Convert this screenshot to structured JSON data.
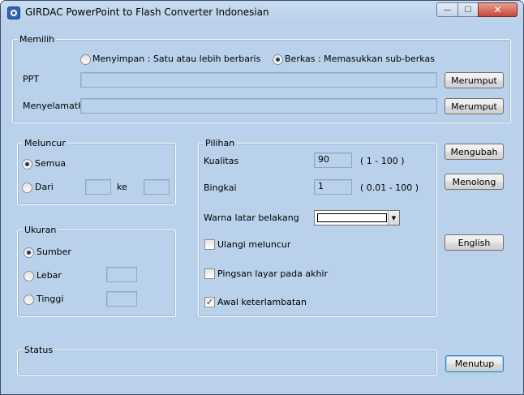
{
  "window": {
    "title": "GIRDAC PowerPoint to Flash Converter Indonesian"
  },
  "controls": {
    "minimize": "—",
    "maximize": "☐",
    "close": "✕"
  },
  "memilih": {
    "label": "Memilih",
    "option_save": "Menyimpan :  Satu atau lebih berbaris",
    "option_folder": "Berkas :  Memasukkan sub-berkas",
    "ppt_label": "PPT",
    "ppt_value": "",
    "save_label": "Menyelamatka",
    "save_value": "",
    "browse1": "Merumput",
    "browse2": "Merumput"
  },
  "meluncur": {
    "label": "Meluncur",
    "all": "Semua",
    "from": "Dari",
    "from_value": "",
    "to": "ke",
    "to_value": ""
  },
  "ukuran": {
    "label": "Ukuran",
    "source": "Sumber",
    "width": "Lebar",
    "width_value": "",
    "height": "Tinggi",
    "height_value": ""
  },
  "pilihan": {
    "label": "Pilihan",
    "quality_label": "Kualitas",
    "quality_value": "90",
    "quality_range": "( 1 - 100 )",
    "frame_label": "Bingkai",
    "frame_value": "1",
    "frame_range": "( 0.01 - 100 )",
    "bg_label": "Warna latar belakang",
    "bg_color": "#ffffff",
    "repeat": "Ulangi meluncur",
    "repeat_checked": false,
    "blank": "Pingsan layar pada akhir",
    "blank_checked": false,
    "delay": "Awal keterlambatan",
    "delay_checked": true
  },
  "buttons": {
    "convert": "Mengubah",
    "help": "Menolong",
    "language": "English",
    "close": "Menutup"
  },
  "status": {
    "label": "Status",
    "text": ""
  }
}
